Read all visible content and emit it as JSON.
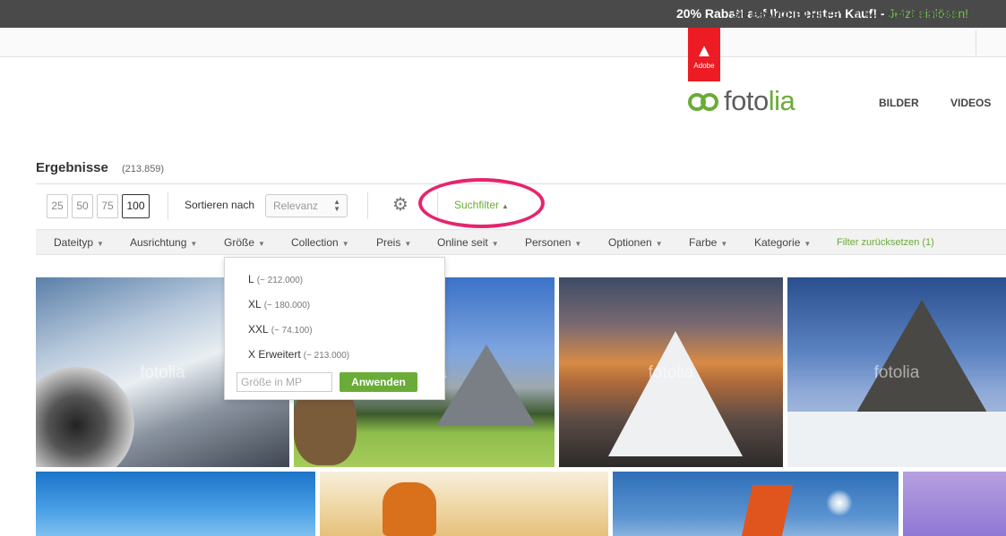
{
  "promo": {
    "text": "20% Rabatt auf Ihren ersten Kauf! - ",
    "link": "Jetzt einlösen!"
  },
  "help": {
    "label": "SIE BRAUCHEN HILFE?",
    "phone": "+49 (0)30 208 96 208"
  },
  "adobe": {
    "label": "Adobe"
  },
  "logo": {
    "part1": "foto",
    "part2": "lia"
  },
  "nav": {
    "bilder": "BILDER",
    "videos": "VIDEOS"
  },
  "results": {
    "title": "Ergebnisse",
    "count": "(213.859)"
  },
  "per_page": [
    "25",
    "50",
    "75",
    "100"
  ],
  "sort": {
    "label": "Sortieren nach",
    "value": "Relevanz"
  },
  "filter_toggle": "Suchfilter",
  "filters": [
    "Dateityp",
    "Ausrichtung",
    "Größe",
    "Collection",
    "Preis",
    "Online seit",
    "Personen",
    "Optionen",
    "Farbe",
    "Kategorie"
  ],
  "reset": "Filter zurücksetzen (1)",
  "size_dropdown": {
    "options": [
      {
        "label": "L",
        "count": "(~ 212.000)"
      },
      {
        "label": "XL",
        "count": "(~ 180.000)"
      },
      {
        "label": "XXL",
        "count": "(~ 74.100)"
      },
      {
        "label": "X Erweitert",
        "count": "(~ 213.000)"
      }
    ],
    "input_placeholder": "Größe in MP",
    "apply": "Anwenden"
  },
  "watermark": "fotolia",
  "colors": {
    "accent": "#6aac37",
    "highlight": "#e6256e",
    "adobe": "#ed1c24"
  }
}
